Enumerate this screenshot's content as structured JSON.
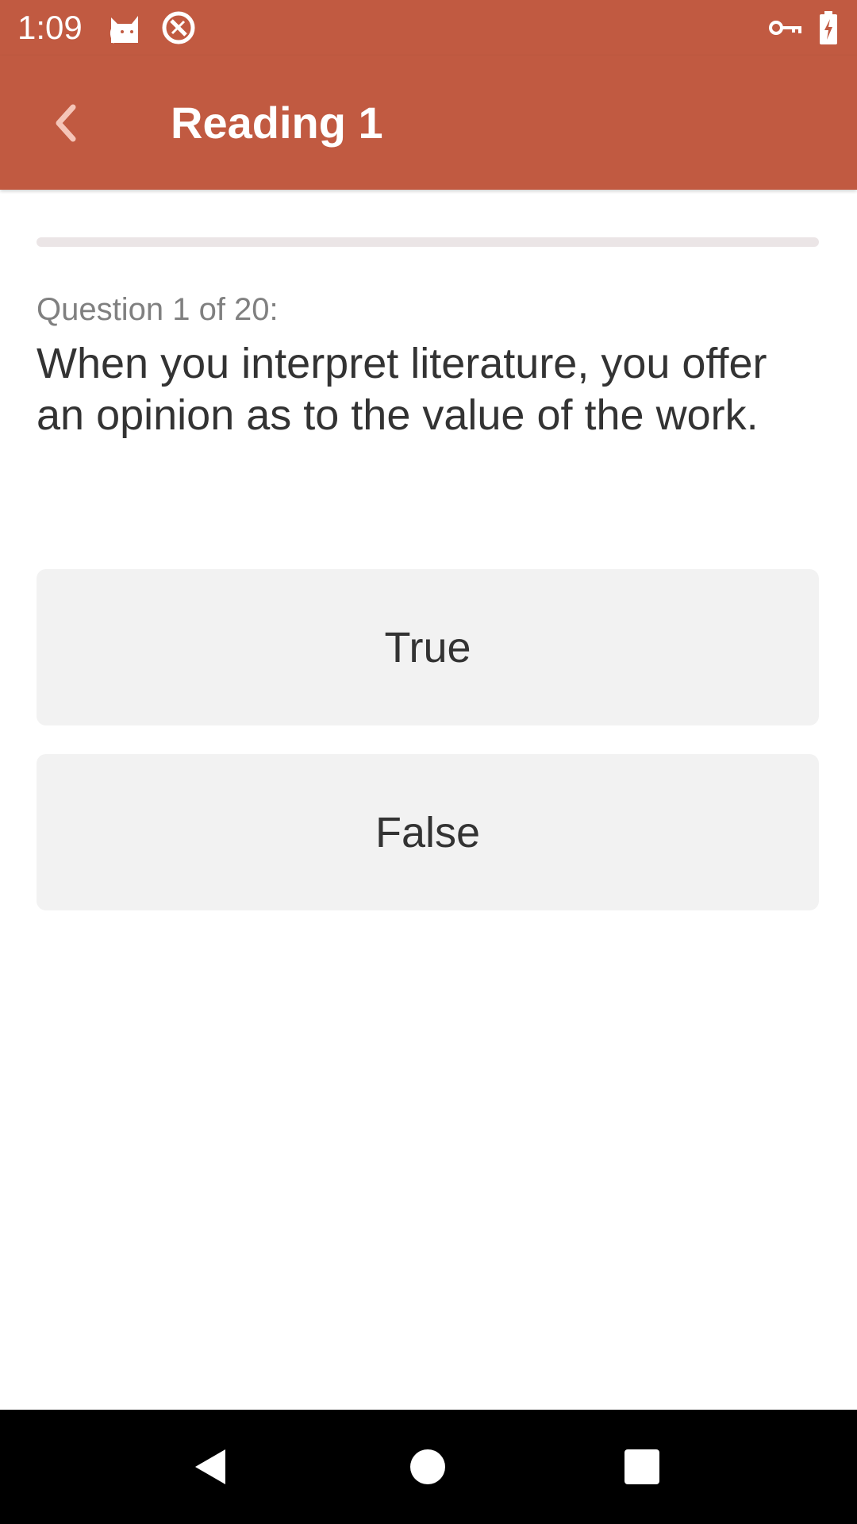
{
  "status_bar": {
    "time": "1:09",
    "icons": [
      "cat-notification-icon",
      "no-data-icon",
      "vpn-key-icon",
      "battery-charging-icon"
    ]
  },
  "app_bar": {
    "title": "Reading 1",
    "back_icon": "chevron-left-icon"
  },
  "quiz": {
    "progress_fraction": 0,
    "counter": "Question 1 of 20:",
    "question": "When you interpret literature, you offer an opinion as to the value of the work.",
    "answers": [
      {
        "label": "True"
      },
      {
        "label": "False"
      }
    ]
  },
  "nav_bar": {
    "icons": [
      "back-triangle-icon",
      "home-circle-icon",
      "recents-square-icon"
    ]
  },
  "colors": {
    "accent": "#c15a41",
    "button_bg": "#f2f2f2",
    "text": "#333333",
    "muted_text": "#808080",
    "progress_track": "#ebe5e6"
  }
}
